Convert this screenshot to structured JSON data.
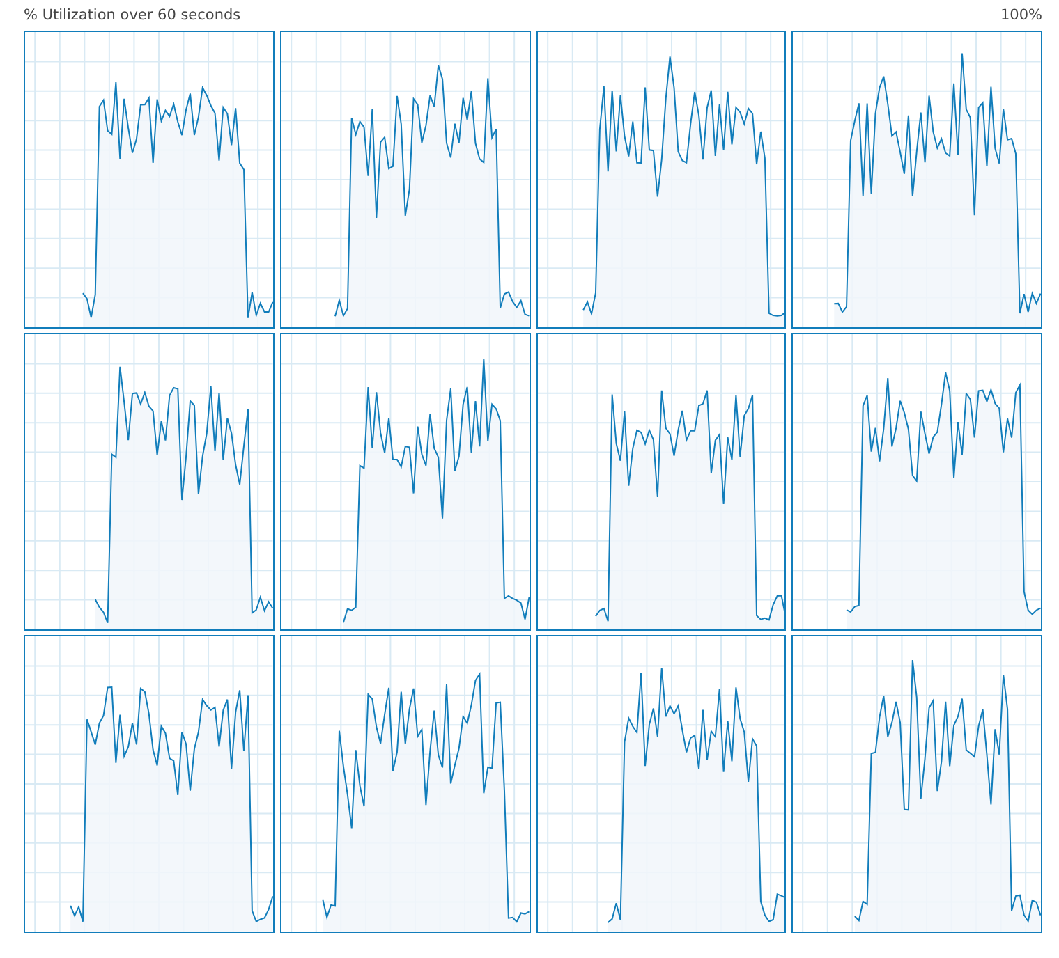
{
  "header": {
    "title": "% Utilization over 60 seconds",
    "max_label": "100%"
  },
  "graphs": [
    {
      "kind": "sparkline"
    },
    {
      "kind": "sparkline"
    },
    {
      "kind": "sparkline"
    },
    {
      "kind": "sparkline"
    },
    {
      "kind": "sparkline"
    },
    {
      "kind": "sparkline"
    },
    {
      "kind": "sparkline"
    },
    {
      "kind": "sparkline"
    },
    {
      "kind": "sparkline"
    },
    {
      "kind": "sparkline"
    },
    {
      "kind": "sparkline"
    },
    {
      "kind": "sparkline"
    }
  ]
}
